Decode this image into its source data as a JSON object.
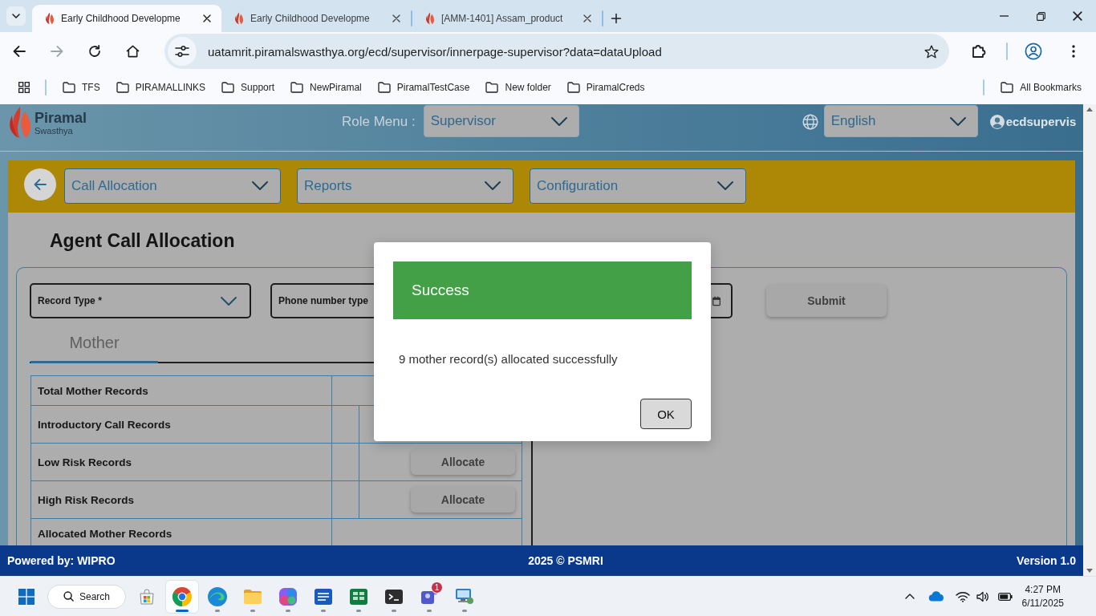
{
  "browser": {
    "tabs": [
      {
        "title": "Early Childhood Developme",
        "selected": true
      },
      {
        "title": "Early Childhood Developme",
        "selected": false
      },
      {
        "title": "[AMM-1401] Assam_product",
        "selected": false
      }
    ],
    "address": "uatamrit.piramalswasthya.org/ecd/supervisor/innerpage-supervisor?data=dataUpload",
    "bookmarks": [
      "TFS",
      "PIRAMALLINKS",
      "Support",
      "NewPiramal",
      "PiramalTestCase",
      "New folder",
      "PiramalCreds"
    ],
    "all_bookmarks": "All Bookmarks"
  },
  "header": {
    "brand": "Piramal",
    "brand_subtitle": "Swasthya",
    "role_label": "Role Menu :",
    "role": "Supervisor",
    "language": "English",
    "user": "ecdsupervis"
  },
  "nav": {
    "menus": [
      "Call Allocation",
      "Reports",
      "Configuration"
    ]
  },
  "page": {
    "title": "Agent Call Allocation",
    "record_type": {
      "label": "Record Type *"
    },
    "phone_type": {
      "label": "Phone number type"
    },
    "submit": {
      "label": "Submit",
      "disabled": true
    },
    "tabs": [
      {
        "label": "Mother",
        "selected": true
      }
    ],
    "table": {
      "rows": [
        {
          "kind": "merged",
          "label": "Total Mother Records"
        },
        {
          "kind": "split",
          "label": "Introductory Call Records"
        },
        {
          "kind": "split",
          "label": "Low Risk Records",
          "action": {
            "label": "Allocate",
            "disabled": true
          }
        },
        {
          "kind": "split",
          "label": "High Risk Records",
          "action": {
            "label": "Allocate",
            "disabled": true
          }
        },
        {
          "kind": "merged",
          "label": "Allocated Mother Records"
        }
      ]
    }
  },
  "dialog": {
    "title": "Success",
    "message": "9 mother record(s) allocated successfully",
    "button": "OK"
  },
  "footer": {
    "powered_by": "Powered by: WIPRO",
    "copyright": "2025 © PSMRI",
    "version": "Version 1.0"
  },
  "taskbar": {
    "search": "Search",
    "apps": [
      {
        "kind": "store",
        "running": false,
        "selected": false
      },
      {
        "kind": "chrome",
        "running": true,
        "selected": true
      },
      {
        "kind": "edge",
        "running": true,
        "selected": false
      },
      {
        "kind": "explorer",
        "running": true,
        "selected": false
      },
      {
        "kind": "m365",
        "running": true,
        "selected": false
      },
      {
        "kind": "word",
        "running": true,
        "selected": false
      },
      {
        "kind": "excel",
        "running": true,
        "selected": false
      },
      {
        "kind": "terminal",
        "running": true,
        "selected": false
      },
      {
        "kind": "teams",
        "running": true,
        "selected": false,
        "badge": "1"
      },
      {
        "kind": "remote",
        "running": true,
        "selected": false
      }
    ],
    "time": "4:27 PM",
    "date": "6/11/2025"
  }
}
